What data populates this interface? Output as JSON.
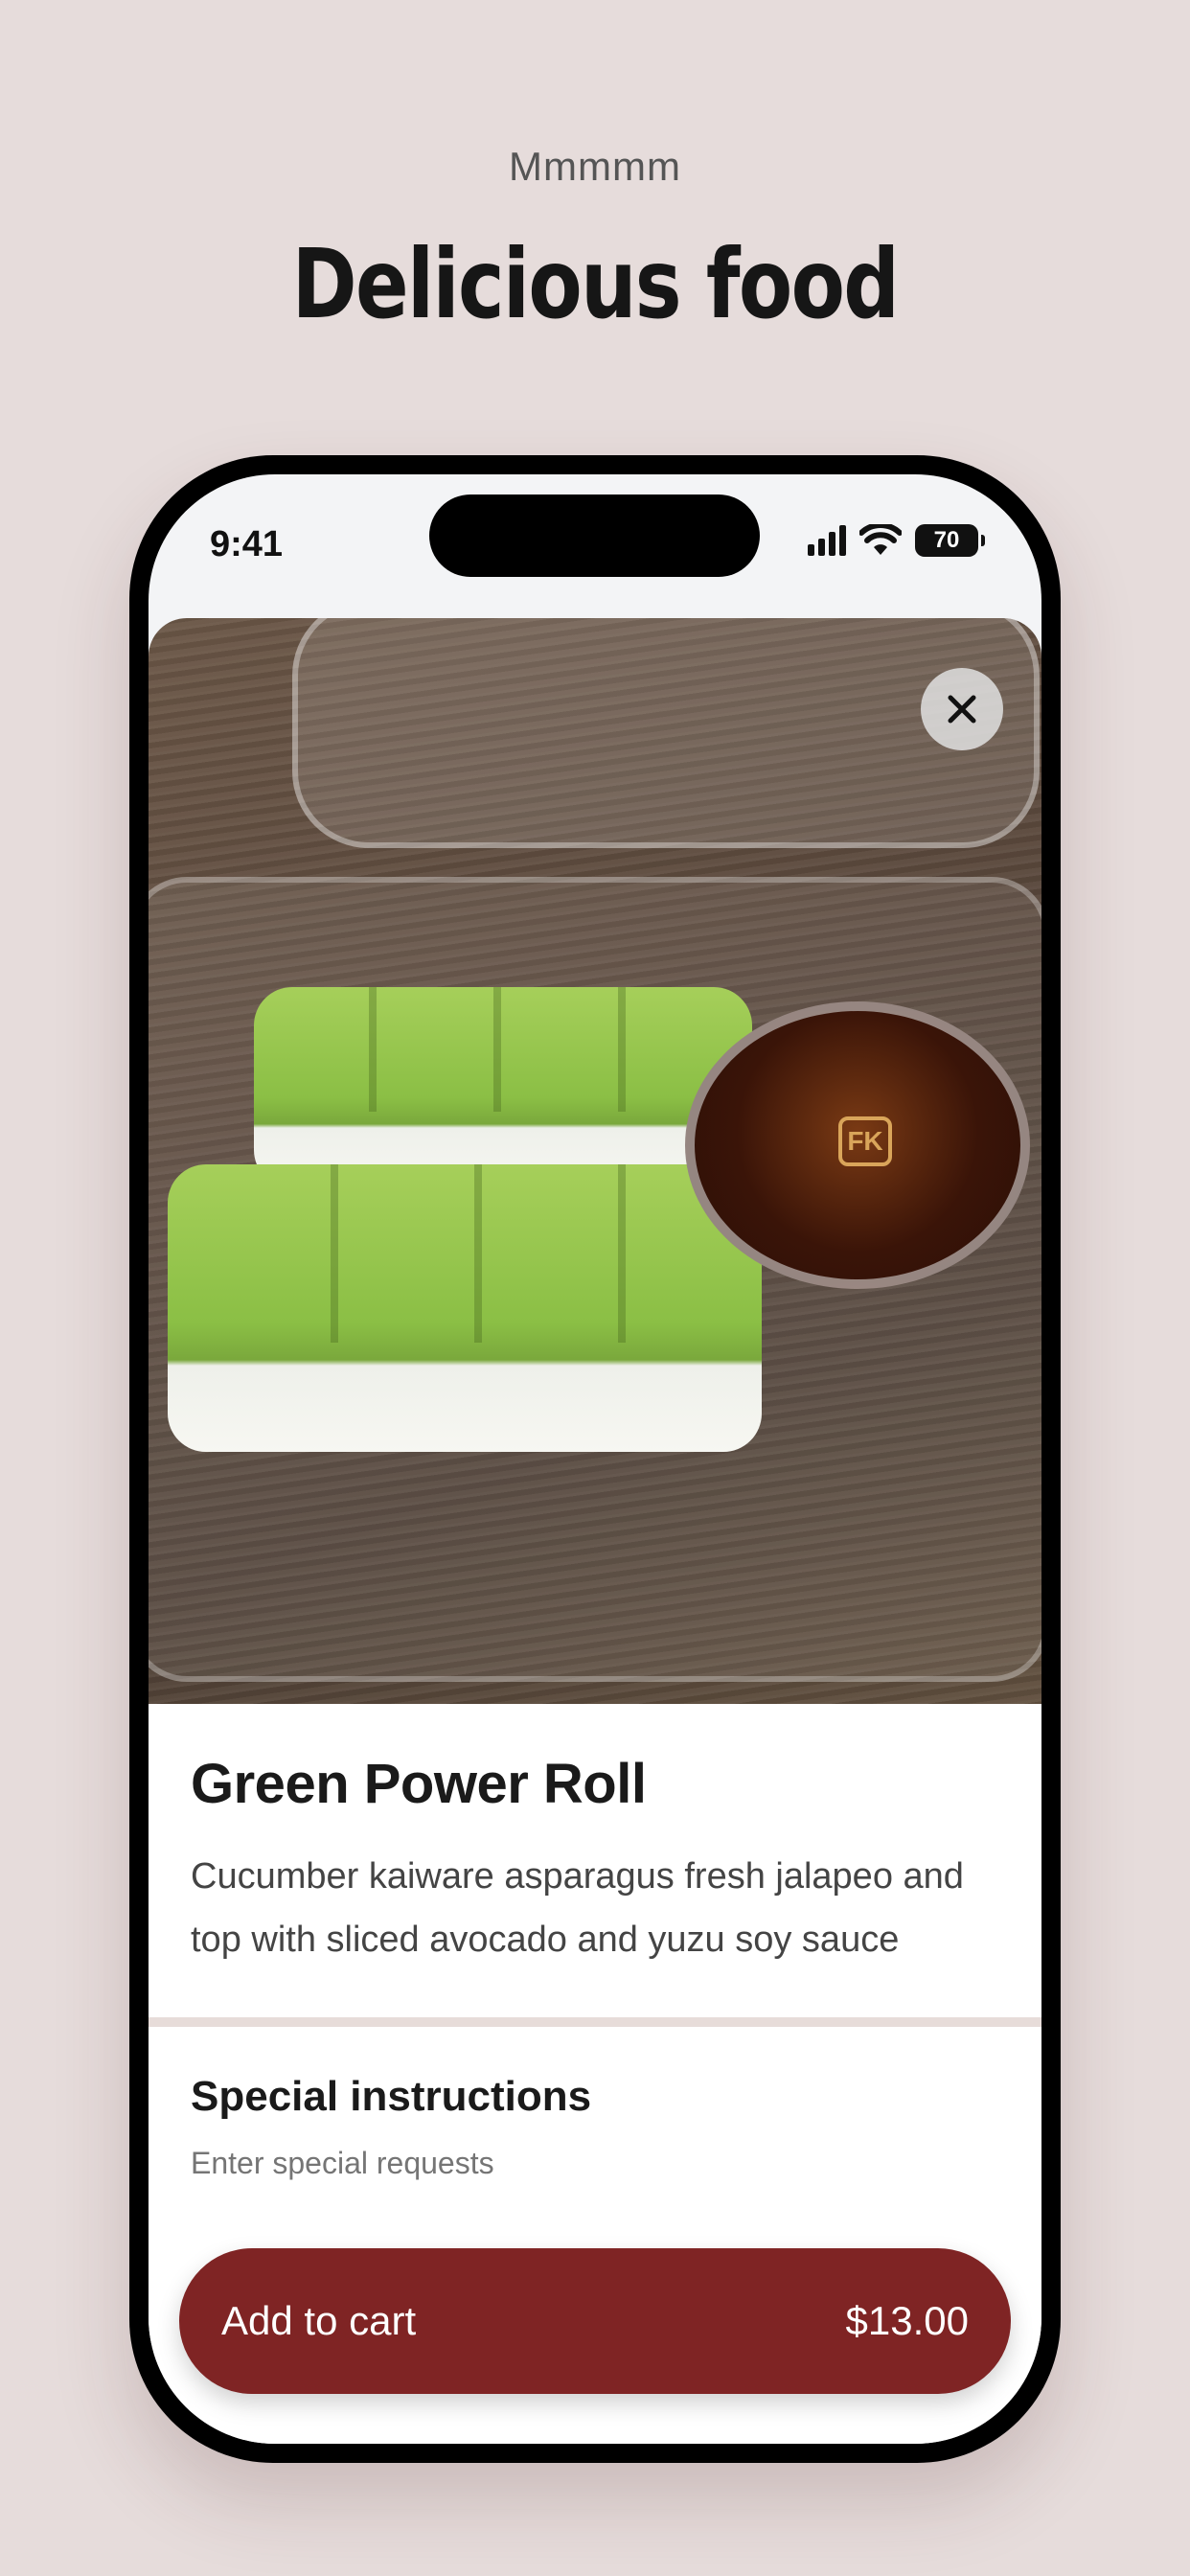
{
  "header": {
    "eyebrow": "Mmmmm",
    "headline": "Delicious food"
  },
  "status_bar": {
    "time": "9:41",
    "battery": "70",
    "icons": [
      "signal-icon",
      "wifi-icon",
      "battery-icon"
    ]
  },
  "item": {
    "photo_icon": "close-icon",
    "sauce_cup_mark": "FK",
    "title": "Green Power Roll",
    "description": "Cucumber kaiware asparagus fresh jalapeo and top with sliced avocado and yuzu soy sauce"
  },
  "special_instructions": {
    "title": "Special instructions",
    "placeholder": "Enter special requests"
  },
  "cart": {
    "label": "Add to cart",
    "price": "$13.00"
  },
  "colors": {
    "background": "#e6dcdb",
    "accent": "#7f2424"
  }
}
